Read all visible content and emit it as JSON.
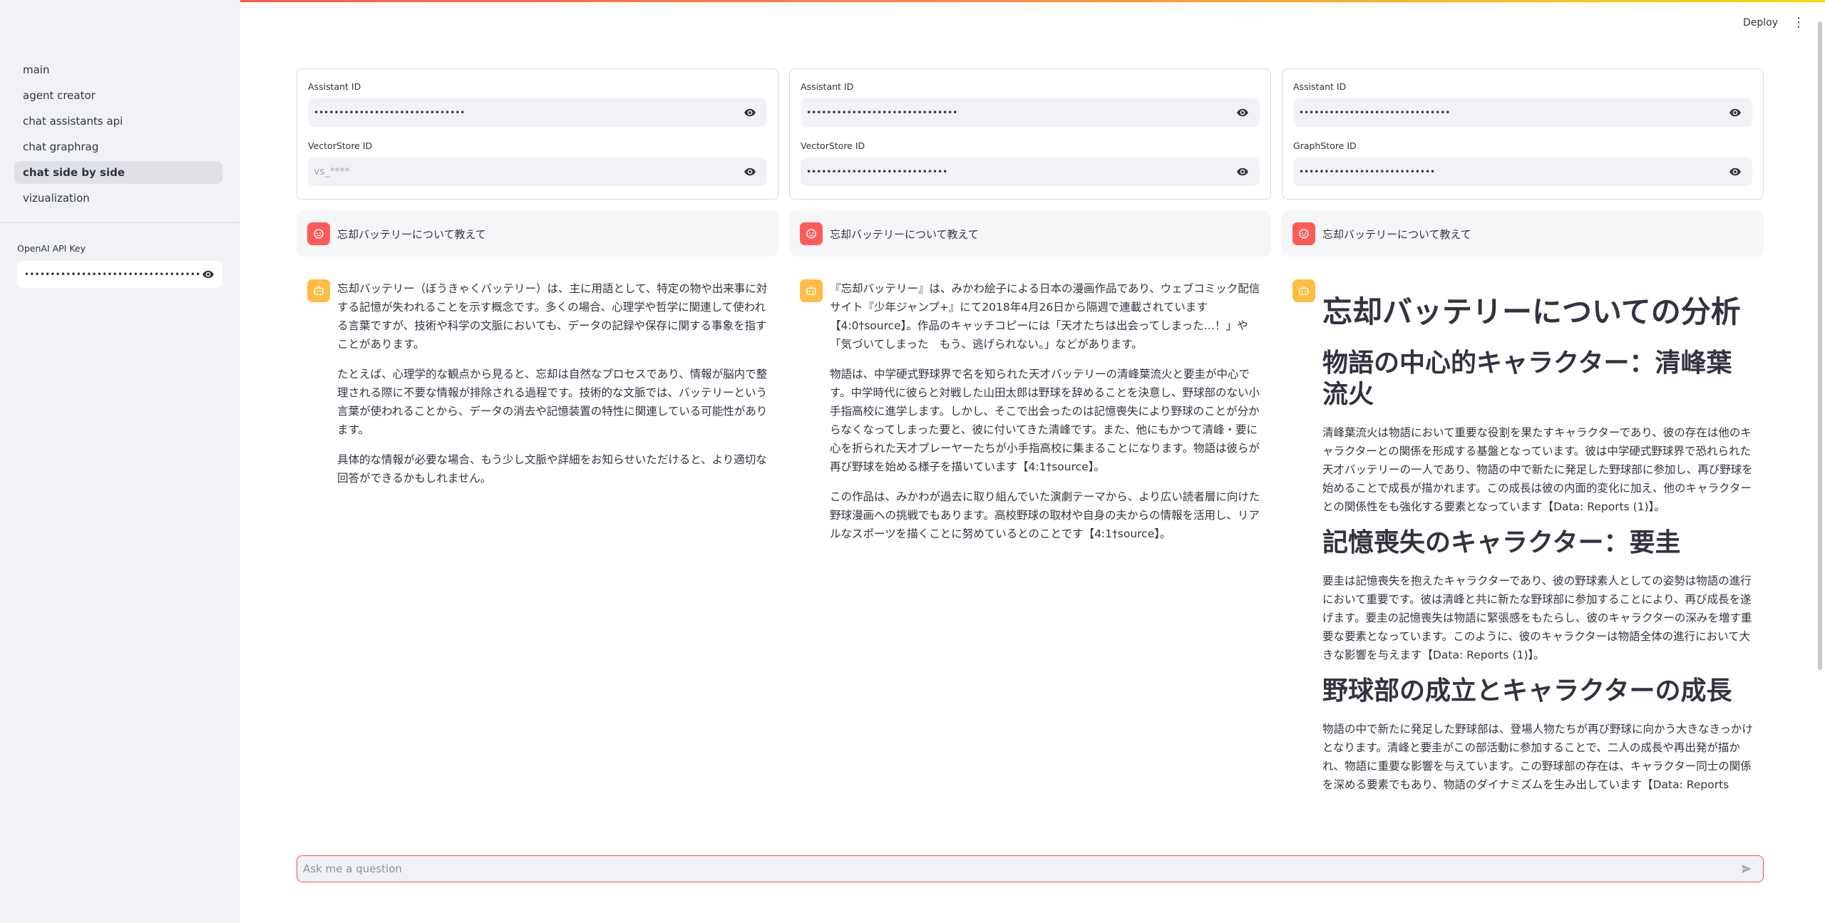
{
  "header": {
    "deploy_label": "Deploy",
    "menu_icon": "kebab-menu-icon"
  },
  "sidebar": {
    "items": [
      {
        "label": "main",
        "active": false
      },
      {
        "label": "agent creator",
        "active": false
      },
      {
        "label": "chat assistants api",
        "active": false
      },
      {
        "label": "chat graphrag",
        "active": false
      },
      {
        "label": "chat side by side",
        "active": true
      },
      {
        "label": "vizualization",
        "active": false
      }
    ],
    "api_key_label": "OpenAI API Key",
    "api_key_value": "••••••••••••••••••••••••••••••••••••••••••••••••••••"
  },
  "columns": [
    {
      "field1_label": "Assistant ID",
      "field1_value": "••••••••••••••••••••••••••••••",
      "field2_label": "VectorStore ID",
      "field2_value": "",
      "field2_placeholder": "vs_****",
      "user_message": "忘却バッテリーについて教えて",
      "answer": {
        "p1": "忘却バッテリー（ぼうきゃくバッテリー）は、主に用語として、特定の物や出来事に対する記憶が失われることを示す概念です。多くの場合、心理学や哲学に関連して使われる言葉ですが、技術や科学の文脈においても、データの記録や保存に関する事象を指すことがあります。",
        "p2": "たとえば、心理学的な観点から見ると、忘却は自然なプロセスであり、情報が脳内で整理される際に不要な情報が排除される過程です。技術的な文脈では、バッテリーという言葉が使われることから、データの消去や記憶装置の特性に関連している可能性があります。",
        "p3": "具体的な情報が必要な場合、もう少し文脈や詳細をお知らせいただけると、より適切な回答ができるかもしれません。"
      }
    },
    {
      "field1_label": "Assistant ID",
      "field1_value": "••••••••••••••••••••••••••••••",
      "field2_label": "VectorStore ID",
      "field2_value": "••••••••••••••••••••••••••••",
      "user_message": "忘却バッテリーについて教えて",
      "answer": {
        "p1": "『忘却バッテリー』は、みかわ絵子による日本の漫画作品であり、ウェブコミック配信サイト『少年ジャンプ+』にて2018年4月26日から隔週で連載されています【4:0†source】。作品のキャッチコピーには「天才たちは出会ってしまった…！」や「気づいてしまった　もう、逃げられない。」などがあります。",
        "p2": "物語は、中学硬式野球界で名を知られた天才バッテリーの清峰葉流火と要圭が中心です。中学時代に彼らと対戦した山田太郎は野球を辞めることを決意し、野球部のない小手指高校に進学します。しかし、そこで出会ったのは記憶喪失により野球のことが分からなくなってしまった要と、彼に付いてきた清峰です。また、他にもかつて清峰・要に心を折られた天才プレーヤーたちが小手指高校に集まることになります。物語は彼らが再び野球を始める様子を描いています【4:1†source】。",
        "p3": "この作品は、みかわが過去に取り組んでいた演劇テーマから、より広い読者層に向けた野球漫画への挑戦でもあります。高校野球の取材や自身の夫からの情報を活用し、リアルなスポーツを描くことに努めているとのことです【4:1†source】。"
      }
    },
    {
      "field1_label": "Assistant ID",
      "field1_value": "••••••••••••••••••••••••••••••",
      "field2_label": "GraphStore ID",
      "field2_value": "•••••••••••••••••••••••••••",
      "user_message": "忘却バッテリーについて教えて",
      "answer": {
        "h1": "忘却バッテリーについての分析",
        "h2a": "物語の中心的キャラクター：清峰葉流火",
        "pa": "清峰葉流火は物語において重要な役割を果たすキャラクターであり、彼の存在は他のキャラクターとの関係を形成する基盤となっています。彼は中学硬式野球界で恐れられた天才バッテリーの一人であり、物語の中で新たに発足した野球部に参加し、再び野球を始めることで成長が描かれます。この成長は彼の内面的変化に加え、他のキャラクターとの関係性をも強化する要素となっています【Data: Reports (1)】。",
        "h2b": "記憶喪失のキャラクター：要圭",
        "pb": "要圭は記憶喪失を抱えたキャラクターであり、彼の野球素人としての姿勢は物語の進行において重要です。彼は清峰と共に新たな野球部に参加することにより、再び成長を遂げます。要圭の記憶喪失は物語に緊張感をもたらし、彼のキャラクターの深みを増す重要な要素となっています。このように、彼のキャラクターは物語全体の進行において大きな影響を与えます【Data: Reports (1)】。",
        "h2c": "野球部の成立とキャラクターの成長",
        "pc": "物語の中で新たに発足した野球部は、登場人物たちが再び野球に向かう大きなきっかけとなります。清峰と要圭がこの部活動に参加することで、二人の成長や再出発が描かれ、物語に重要な影響を与えています。この野球部の存在は、キャラクター同士の関係を深める要素でもあり、物語のダイナミズムを生み出しています【Data: Reports"
      }
    }
  ],
  "chat_input": {
    "placeholder": "Ask me a question"
  }
}
